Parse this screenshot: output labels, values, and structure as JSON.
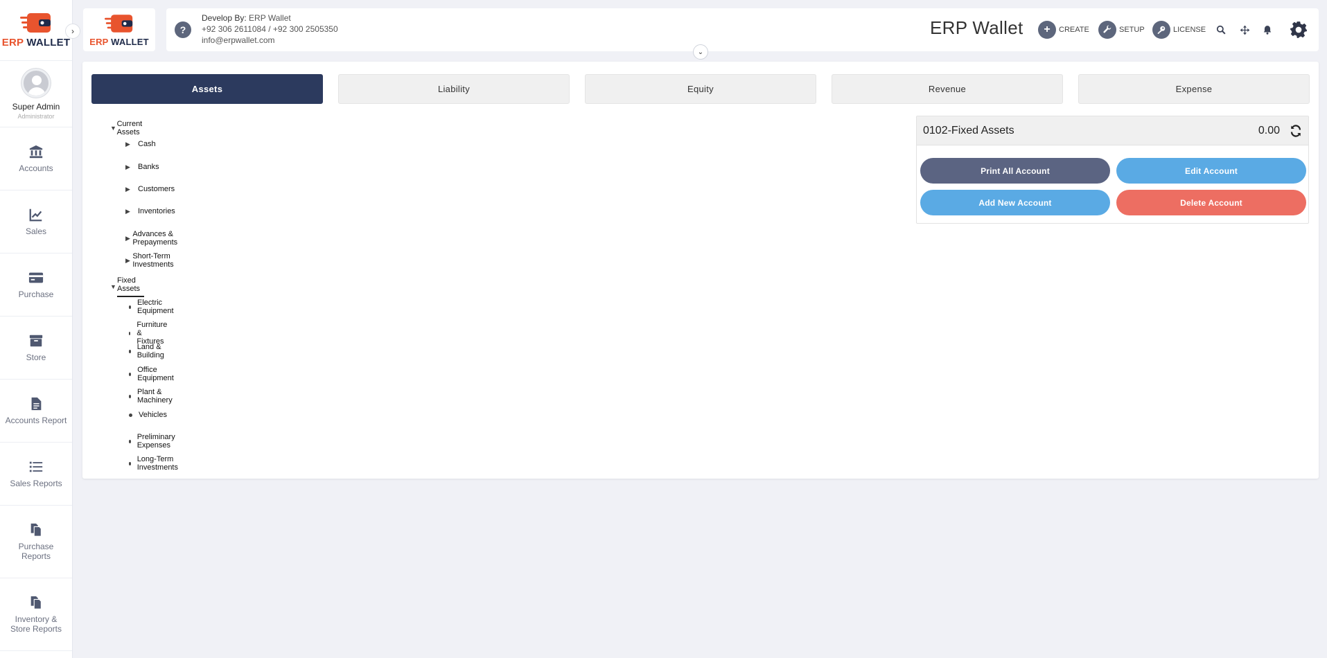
{
  "brand": {
    "logo_word1": "ERP",
    "logo_word2": "WALLET"
  },
  "sidebar": {
    "profile": {
      "name": "Super Admin",
      "role": "Administrator"
    },
    "items": [
      {
        "label": "Accounts",
        "icon": "bank-icon"
      },
      {
        "label": "Sales",
        "icon": "chart-line-icon"
      },
      {
        "label": "Purchase",
        "icon": "credit-card-icon"
      },
      {
        "label": "Store",
        "icon": "archive-box-icon"
      },
      {
        "label": "Accounts Report",
        "icon": "document-icon"
      },
      {
        "label": "Sales Reports",
        "icon": "list-icon"
      },
      {
        "label": "Purchase Reports",
        "icon": "copy-icon"
      },
      {
        "label": "Inventory & Store Reports",
        "icon": "copy-icon"
      }
    ]
  },
  "header": {
    "dev_prefix": "Develop By:",
    "dev_name": "ERP Wallet",
    "phones": "+92 306 2611084 / +92 300 2505350",
    "email": "info@erpwallet.com",
    "app_title": "ERP Wallet",
    "create_label": "CREATE",
    "setup_label": "SETUP",
    "license_label": "LICENSE"
  },
  "tabs": [
    {
      "label": "Assets",
      "active": true
    },
    {
      "label": "Liability",
      "active": false
    },
    {
      "label": "Equity",
      "active": false
    },
    {
      "label": "Revenue",
      "active": false
    },
    {
      "label": "Expense",
      "active": false
    }
  ],
  "tree": {
    "current_assets": {
      "label": "Current Assets",
      "children": [
        "Cash",
        "Banks",
        "Customers",
        "Inventories",
        "Advances & Prepayments",
        "Short-Term Investments"
      ]
    },
    "fixed_assets": {
      "label": "Fixed Assets",
      "children": [
        "Electric Equipment",
        "Furniture & Fixtures",
        "Land & Building",
        "Office Equipment",
        "Plant & Machinery",
        "Vehicles",
        "Preliminary Expenses",
        "Long-Term Investments"
      ]
    }
  },
  "account_panel": {
    "title": "0102-Fixed Assets",
    "balance": "0.00",
    "print_all": "Print All Account",
    "edit": "Edit Account",
    "add_new": "Add New Account",
    "delete": "Delete Account"
  },
  "colors": {
    "navy": "#2c3a5e",
    "slate_button": "#5b6482",
    "blue_button": "#5aaae4",
    "red_button": "#ed6e62",
    "brand_orange": "#e8542e"
  }
}
